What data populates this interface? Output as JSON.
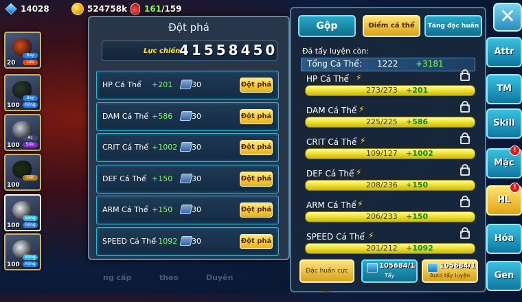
{
  "topbar": {
    "gems": "14028",
    "gold": "524758k",
    "stamina": "161",
    "stamina_max": "/159"
  },
  "party": [
    {
      "level": "20",
      "tag1": "Bay",
      "tag2": "Lửa"
    },
    {
      "level": "100",
      "tag1": "Bay",
      "tag2": "Rồng"
    },
    {
      "level": "100",
      "tag1": "Ác",
      "tag2": "Siêu"
    },
    {
      "level": "100",
      "tag1": "Đất",
      "tag2": ""
    },
    {
      "level": "100",
      "tag1": "Băng",
      "tag2": "Rồng"
    },
    {
      "level": "100",
      "tag1": "Băng",
      "tag2": "Rồng"
    }
  ],
  "breakthrough": {
    "title": "Đột phá",
    "power_label": "Lực chiến",
    "power_value": "41558450",
    "button_label": "Đột phá",
    "rows": [
      {
        "name": "HP Cá Thể",
        "bonus": "+201",
        "cost": "30"
      },
      {
        "name": "DAM Cá Thể",
        "bonus": "+586",
        "cost": "30"
      },
      {
        "name": "CRIT Cá Thể",
        "bonus": "+1002",
        "cost": "30"
      },
      {
        "name": "DEF Cá Thể",
        "bonus": "+150",
        "cost": "30"
      },
      {
        "name": "ARM Cá Thể",
        "bonus": "+150",
        "cost": "30"
      },
      {
        "name": "SPEED Cá Thể",
        "bonus": "+1092",
        "cost": "30"
      }
    ]
  },
  "training": {
    "tabs": [
      "Gộp",
      "Điểm cá thể",
      "Tăng đặc huấn"
    ],
    "remaining_label": "Đá tẩy luyện còn:",
    "total_label": "Tổng Cá Thể:",
    "total_value": "1222",
    "total_bonus": "+3181",
    "stats": [
      {
        "name": "HP Cá Thể",
        "value": "273/273",
        "bonus": "+201",
        "fill": 1.0
      },
      {
        "name": "DAM Cá Thể",
        "value": "225/225",
        "bonus": "+586",
        "fill": 1.0
      },
      {
        "name": "CRIT Cá Thể",
        "value": "109/127",
        "bonus": "+1002",
        "fill": 0.86
      },
      {
        "name": "DEF Cá Thể",
        "value": "208/236",
        "bonus": "+150",
        "fill": 0.88
      },
      {
        "name": "ARM Cá Thể",
        "value": "206/233",
        "bonus": "+150",
        "fill": 0.88
      },
      {
        "name": "SPEED Cá Thể",
        "value": "201/212",
        "bonus": "+1092",
        "fill": 0.95
      }
    ],
    "btn_special": "Đặc huấn cực hạn",
    "btn_wash_count": "105684/1",
    "btn_wash_label": "Tẩy",
    "btn_auto_count": "105684/1",
    "btn_auto_label": "Auto tẩy luyện"
  },
  "side": {
    "close": "✕",
    "buttons": [
      "Attr",
      "TM",
      "Skill",
      "Mặc",
      "HL",
      "Hóa",
      "Gen"
    ],
    "badge": "!"
  },
  "bottom_nav": [
    "ng cấp",
    "theo",
    "Duyên"
  ],
  "colors": {
    "accent_cyan": "#2aa8c8",
    "accent_gold": "#e6b020",
    "bonus_green": "#7dff5a"
  }
}
